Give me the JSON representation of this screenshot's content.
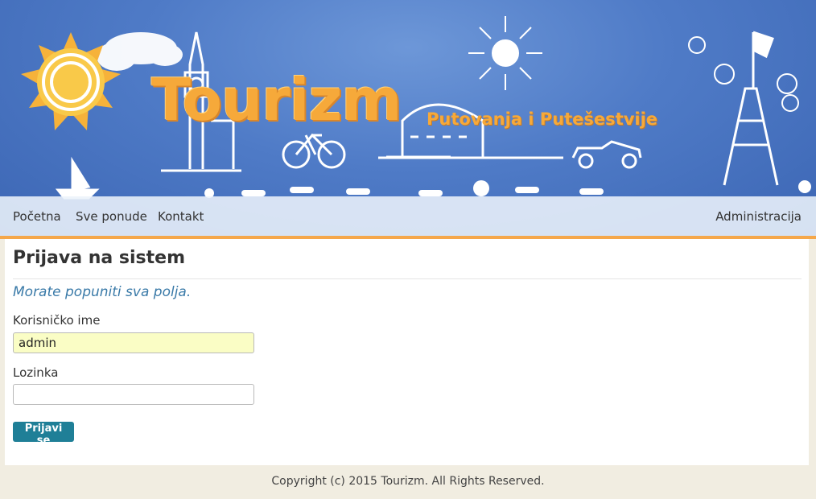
{
  "header": {
    "logo": "Tourizm",
    "tagline": "Putovanja i Putešestvije"
  },
  "nav": {
    "items": [
      "Početna",
      "Sve ponude",
      "Kontakt"
    ],
    "admin": "Administracija"
  },
  "login": {
    "title": "Prijava na sistem",
    "validation": "Morate popuniti sva polja.",
    "username_label": "Korisničko ime",
    "username_value": "admin",
    "password_label": "Lozinka",
    "password_value": "",
    "submit_label": "Prijavi se"
  },
  "footer": {
    "copyright": "Copyright (c) 2015 Tourizm. All Rights Reserved."
  },
  "colors": {
    "accent": "#f5a74a",
    "button": "#1f7f97",
    "link_text": "#3a7aa8",
    "autofill_bg": "#fafdc5"
  }
}
